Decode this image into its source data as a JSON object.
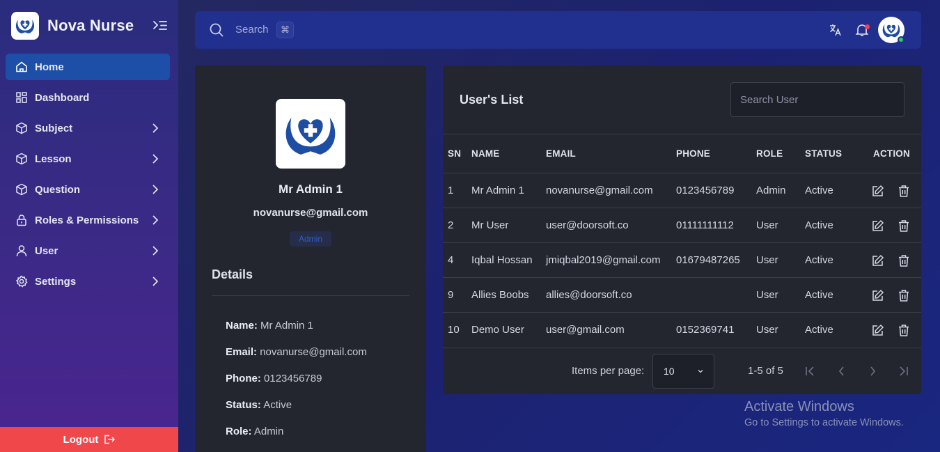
{
  "brand": {
    "name": "Nova Nurse"
  },
  "sidebar": {
    "items": [
      {
        "label": "Home",
        "icon": "home-icon",
        "active": true,
        "has_submenu": false
      },
      {
        "label": "Dashboard",
        "icon": "dashboard-icon",
        "active": false,
        "has_submenu": false
      },
      {
        "label": "Subject",
        "icon": "cube-icon",
        "active": false,
        "has_submenu": true
      },
      {
        "label": "Lesson",
        "icon": "cube-icon",
        "active": false,
        "has_submenu": true
      },
      {
        "label": "Question",
        "icon": "cube-icon",
        "active": false,
        "has_submenu": true
      },
      {
        "label": "Roles & Permissions",
        "icon": "lock-icon",
        "active": false,
        "has_submenu": true
      },
      {
        "label": "User",
        "icon": "user-icon",
        "active": false,
        "has_submenu": true
      },
      {
        "label": "Settings",
        "icon": "gear-icon",
        "active": false,
        "has_submenu": true
      }
    ],
    "logout_label": "Logout"
  },
  "topbar": {
    "search_placeholder": "Search",
    "search_shortcut": "⌘"
  },
  "profile": {
    "name": "Mr Admin 1",
    "email": "novanurse@gmail.com",
    "role_badge": "Admin",
    "details_title": "Details",
    "details": [
      {
        "label": "Name:",
        "value": "Mr Admin 1"
      },
      {
        "label": "Email:",
        "value": "novanurse@gmail.com"
      },
      {
        "label": "Phone:",
        "value": "0123456789"
      },
      {
        "label": "Status:",
        "value": "Active"
      },
      {
        "label": "Role:",
        "value": "Admin"
      }
    ]
  },
  "users": {
    "title": "User's List",
    "search_placeholder": "Search User",
    "columns": [
      "SN",
      "NAME",
      "EMAIL",
      "PHONE",
      "ROLE",
      "STATUS",
      "ACTION"
    ],
    "rows": [
      {
        "sn": "1",
        "name": "Mr Admin 1",
        "email": "novanurse@gmail.com",
        "phone": "0123456789",
        "role": "Admin",
        "status": "Active"
      },
      {
        "sn": "2",
        "name": "Mr User",
        "email": "user@doorsoft.co",
        "phone": "01111111112",
        "role": "User",
        "status": "Active"
      },
      {
        "sn": "4",
        "name": "Iqbal Hossan",
        "email": "jmiqbal2019@gmail.com",
        "phone": "01679487265",
        "role": "User",
        "status": "Active"
      },
      {
        "sn": "9",
        "name": "Allies Boobs",
        "email": "allies@doorsoft.co",
        "phone": "",
        "role": "User",
        "status": "Active"
      },
      {
        "sn": "10",
        "name": "Demo User",
        "email": "user@gmail.com",
        "phone": "0152369741",
        "role": "User",
        "status": "Active"
      }
    ],
    "pagination": {
      "items_per_page_label": "Items per page:",
      "items_per_page": "10",
      "range": "1-5 of 5"
    }
  },
  "watermark": {
    "title": "Activate Windows",
    "subtitle": "Go to Settings to activate Windows."
  },
  "colors": {
    "accent": "#1e4fa8",
    "logout": "#f0474b",
    "card": "#23252f",
    "online": "#2ecc5d",
    "notification": "#ff3b4f"
  }
}
